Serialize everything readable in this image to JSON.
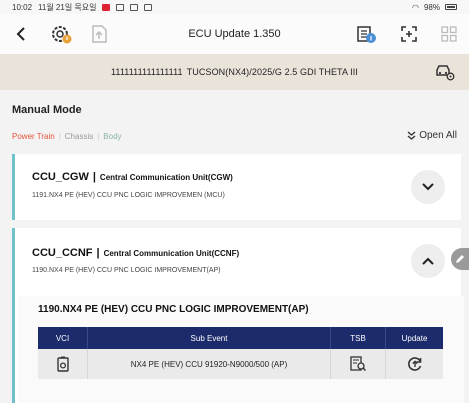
{
  "status_bar": {
    "time": "10:02",
    "date": "11월 21일 목요일",
    "battery": "98%"
  },
  "toolbar": {
    "title": "ECU Update 1.350"
  },
  "vehicle": {
    "vin": "1111111111111111",
    "model": "TUCSON(NX4)/2025/G 2.5 GDI THETA III"
  },
  "main": {
    "mode_title": "Manual Mode",
    "categories": [
      {
        "label": "Power Train"
      },
      {
        "label": "Chassis"
      },
      {
        "label": "Body"
      }
    ],
    "open_all": "Open All"
  },
  "ecus": [
    {
      "code": "CCU_CGW",
      "name": "Central Communication Unit(CGW)",
      "summary": "1191.NX4 PE (HEV) CCU PNC LOGIC IMPROVEMEN (MCU)"
    },
    {
      "code": "CCU_CCNF",
      "name": "Central Communication Unit(CCNF)",
      "summary": "1190.NX4 PE (HEV) CCU PNC LOGIC IMPROVEMENT(AP)",
      "detail_title": "1190.NX4 PE (HEV) CCU PNC LOGIC IMPROVEMENT(AP)",
      "table": {
        "headers": [
          "VCI",
          "Sub Event",
          "TSB",
          "Update"
        ],
        "rows": [
          {
            "sub_event": "NX4 PE (HEV) CCU 91920-N9000/500 (AP)"
          }
        ]
      }
    }
  ],
  "colors": {
    "accent_teal": "#6fc2c9",
    "table_header": "#1c2b6b",
    "active_category": "#e2533b"
  }
}
